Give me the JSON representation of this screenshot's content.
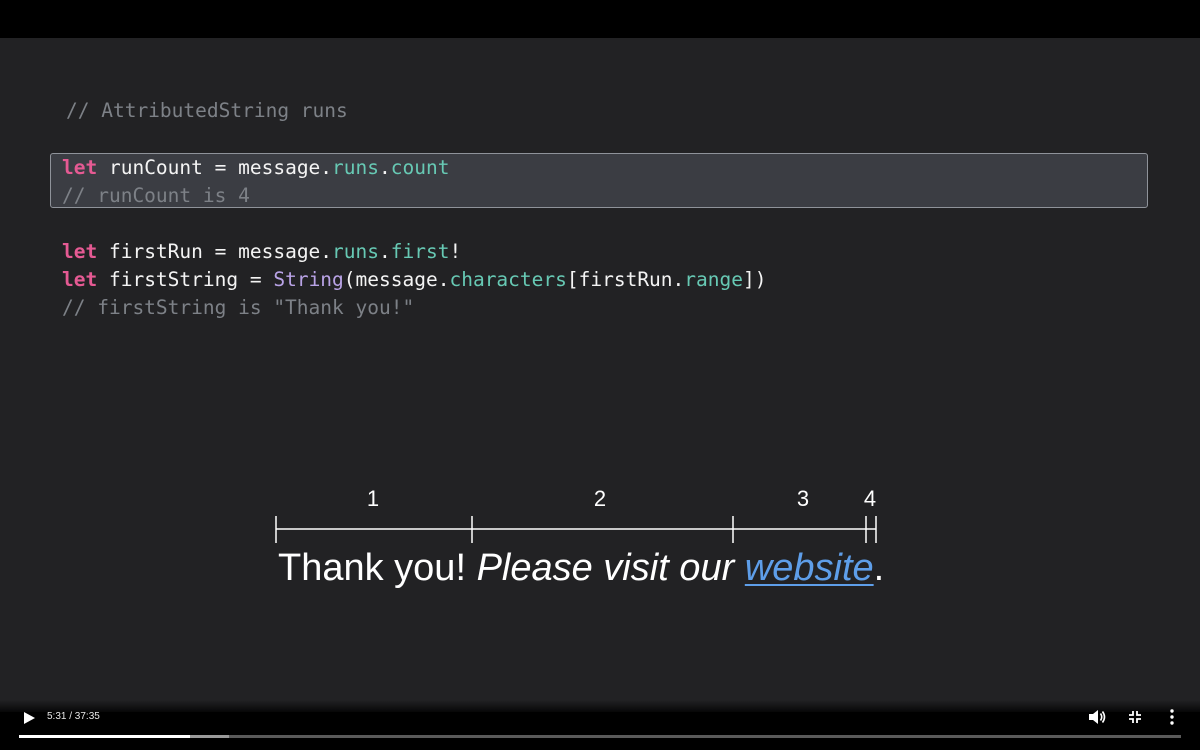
{
  "code": {
    "header_comment": "// AttributedString runs",
    "block1": {
      "kw": "let",
      "var": " runCount = message.",
      "prop1": "runs",
      "dot": ".",
      "prop2": "count",
      "comment": "// runCount is 4"
    },
    "block2": {
      "line1_kw": "let",
      "line1_var": " firstRun = message.",
      "line1_prop1": "runs",
      "line1_dot": ".",
      "line1_prop2": "first",
      "line1_end": "!",
      "line2_kw": "let",
      "line2_var": " firstString = ",
      "line2_type": "String",
      "line2_mid": "(message.",
      "line2_prop1": "characters",
      "line2_mid2": "[firstRun.",
      "line2_prop2": "range",
      "line2_end": "])",
      "comment": "// firstString is \"Thank you!\""
    }
  },
  "runs": {
    "labels": [
      "1",
      "2",
      "3",
      "4"
    ]
  },
  "sentence": {
    "part1": "Thank you! ",
    "part2": "Please visit our ",
    "link": "website",
    "part3": "."
  },
  "player": {
    "time": "5:31 / 37:35",
    "progress_fraction": 0.147,
    "buffer_fraction": 0.181,
    "icons": [
      "play-icon",
      "volume-icon",
      "exit-fullscreen-icon",
      "more-icon"
    ]
  }
}
